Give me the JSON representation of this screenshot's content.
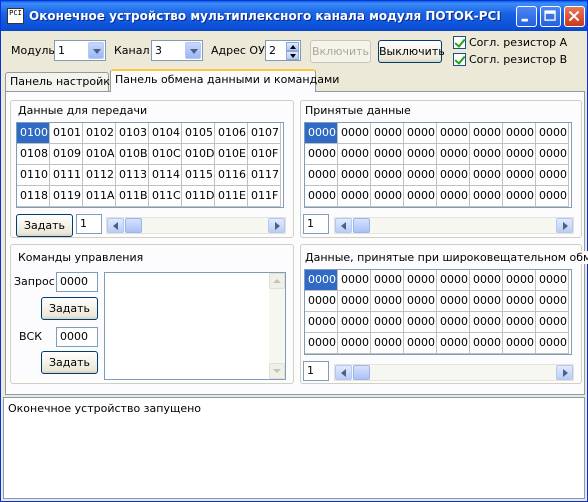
{
  "window": {
    "title": "Оконечное устройство мультиплексного канала модуля ПОТОК-PCI",
    "icon_text": "PCI",
    "controls": [
      "minimize-icon",
      "maximize-icon",
      "close-icon"
    ]
  },
  "toolbar": {
    "module_label": "Модуль",
    "module_value": "1",
    "channel_label": "Канал",
    "channel_value": "3",
    "address_label": "Адрес ОУ",
    "address_value": "2",
    "enable_label": "Включить",
    "disable_label": "Выключить",
    "resistor_a_label": "Согл. резистор А",
    "resistor_a_checked": true,
    "resistor_b_label": "Согл. резистор В",
    "resistor_b_checked": true
  },
  "tabs": [
    "Панель настройки",
    "Панель обмена данными и командами"
  ],
  "active_tab": 1,
  "tx": {
    "title": "Данные для передачи",
    "rows": [
      [
        "0100",
        "0101",
        "0102",
        "0103",
        "0104",
        "0105",
        "0106",
        "0107"
      ],
      [
        "0108",
        "0109",
        "010A",
        "010B",
        "010C",
        "010D",
        "010E",
        "010F"
      ],
      [
        "0110",
        "0111",
        "0112",
        "0113",
        "0114",
        "0115",
        "0116",
        "0117"
      ],
      [
        "0118",
        "0119",
        "011A",
        "011B",
        "011C",
        "011D",
        "011E",
        "011F"
      ]
    ],
    "set_label": "Задать",
    "page_value": "1"
  },
  "rx": {
    "title": "Принятые данные",
    "rows": [
      [
        "0000",
        "0000",
        "0000",
        "0000",
        "0000",
        "0000",
        "0000",
        "0000"
      ],
      [
        "0000",
        "0000",
        "0000",
        "0000",
        "0000",
        "0000",
        "0000",
        "0000"
      ],
      [
        "0000",
        "0000",
        "0000",
        "0000",
        "0000",
        "0000",
        "0000",
        "0000"
      ],
      [
        "0000",
        "0000",
        "0000",
        "0000",
        "0000",
        "0000",
        "0000",
        "0000"
      ]
    ],
    "page_value": "1"
  },
  "commands": {
    "title": "Команды управления",
    "request_label": "Запрос",
    "request_value": "0000",
    "request_set_label": "Задать",
    "vsk_label": "ВСК",
    "vsk_value": "0000",
    "vsk_set_label": "Задать"
  },
  "broadcast": {
    "title": "Данные, принятые при широковещательном обмене",
    "rows": [
      [
        "0000",
        "0000",
        "0000",
        "0000",
        "0000",
        "0000",
        "0000",
        "0000"
      ],
      [
        "0000",
        "0000",
        "0000",
        "0000",
        "0000",
        "0000",
        "0000",
        "0000"
      ],
      [
        "0000",
        "0000",
        "0000",
        "0000",
        "0000",
        "0000",
        "0000",
        "0000"
      ],
      [
        "0000",
        "0000",
        "0000",
        "0000",
        "0000",
        "0000",
        "0000",
        "0000"
      ]
    ],
    "page_value": "1"
  },
  "log": {
    "lines": [
      "Оконечное устройство запущено"
    ]
  },
  "colors": {
    "title_bar": "#0a5fe8",
    "selection": "#316ac5",
    "window_bg": "#ece9d8",
    "tab_highlight": "#ffc83c"
  }
}
